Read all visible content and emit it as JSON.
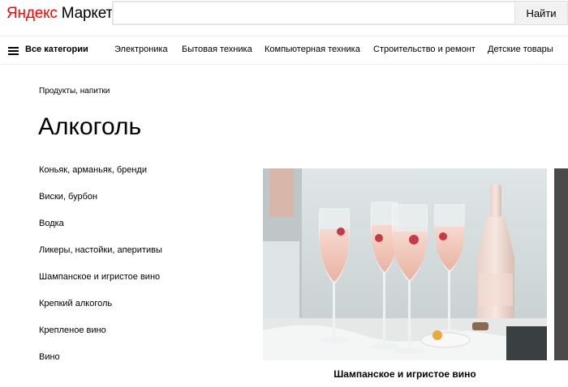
{
  "header": {
    "logo_part1": "Яндекс",
    "logo_part2": "Маркет",
    "search_placeholder": "",
    "search_button": "Найти"
  },
  "nav": {
    "all_categories": "Все категории",
    "items": [
      "Электроника",
      "Бытовая техника",
      "Компьютерная техника",
      "Строительство и ремонт",
      "Детские товары"
    ]
  },
  "breadcrumb": "Продукты, напитки",
  "title": "Алкоголь",
  "categories": [
    "Коньяк, арманьяк, бренди",
    "Виски, бурбон",
    "Водка",
    "Ликеры, настойки, аперитивы",
    "Шампанское и игристое вино",
    "Крепкий алкоголь",
    "Крепленое вино",
    "Вино"
  ],
  "banner": {
    "caption": "Шампанское и игристое вино"
  },
  "colors": {
    "logo_red": "#ff0000",
    "divider": "#ececec",
    "button_bg": "#f2f2f2"
  }
}
